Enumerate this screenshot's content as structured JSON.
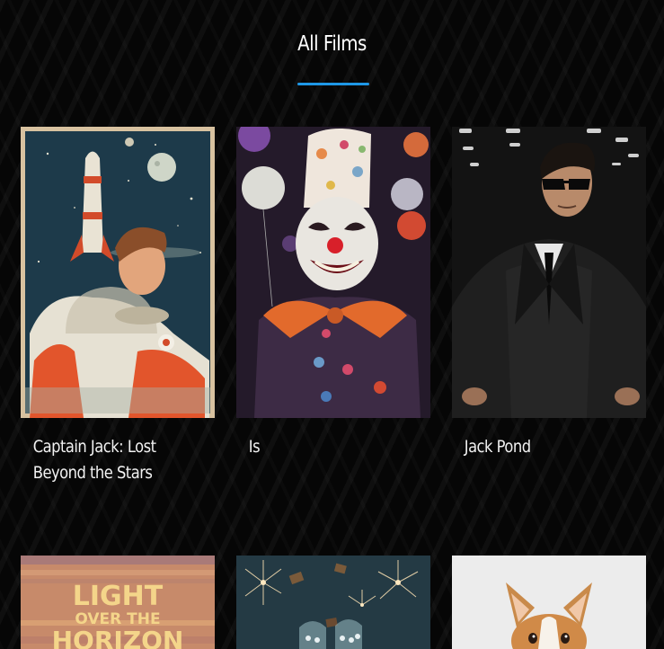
{
  "section": {
    "title": "All Films"
  },
  "colors": {
    "accent": "#1e97e6",
    "background": "#060606"
  },
  "films": [
    {
      "title": "Captain Jack: Lost Beyond the Stars",
      "poster": "astronaut-rocket-poster"
    },
    {
      "title": "Is",
      "poster": "clown-balloons-poster"
    },
    {
      "title": "Jack Pond",
      "poster": "agent-sunglasses-poster"
    },
    {
      "title": "",
      "poster": "light-over-the-horizon-poster",
      "poster_text": [
        "LIGHT",
        "OVER THE",
        "HORIZON"
      ]
    },
    {
      "title": "",
      "poster": "fireworks-castle-poster"
    },
    {
      "title": "",
      "poster": "cartoon-corgi-poster"
    }
  ]
}
